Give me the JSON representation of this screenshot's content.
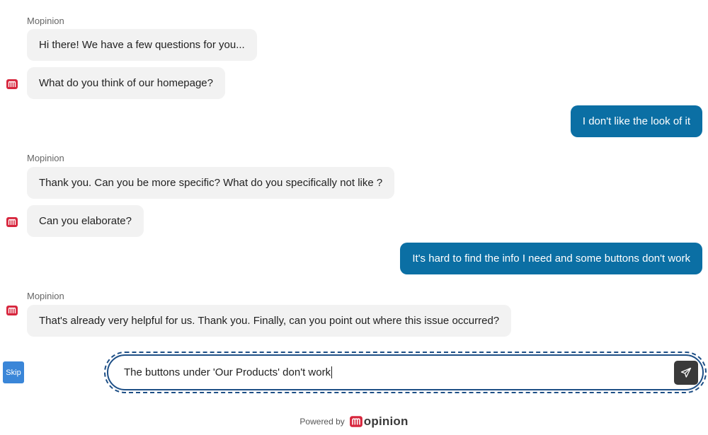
{
  "conversation": {
    "sender_name": "Mopinion",
    "messages": [
      {
        "from": "bot",
        "text": "Hi there! We have a few questions for you..."
      },
      {
        "from": "bot",
        "text": "What do you think of our homepage?"
      },
      {
        "from": "user",
        "text": "I don't like the look of it"
      },
      {
        "from": "bot",
        "text": "Thank you. Can you be more specific? What do you specifically not like ?"
      },
      {
        "from": "bot",
        "text": "Can you elaborate?"
      },
      {
        "from": "user",
        "text": "It's hard to find the info I need and some buttons don't work"
      },
      {
        "from": "bot",
        "text": "That's already very helpful for us. Thank you. Finally, can you point out where this issue occurred?"
      }
    ]
  },
  "composer": {
    "skip_label": "Skip",
    "input_value": "The buttons under 'Our Products' don't work",
    "send_icon": "paper-plane-icon"
  },
  "footer": {
    "powered_by": "Powered by",
    "brand": "opinion",
    "brand_icon": "mopinion-logo-icon"
  },
  "colors": {
    "user_bubble": "#0b6fa4",
    "bot_bubble": "#f2f2f2",
    "brand_red": "#d7263d",
    "input_border": "#1e4f86",
    "skip_button": "#3a86d8"
  }
}
